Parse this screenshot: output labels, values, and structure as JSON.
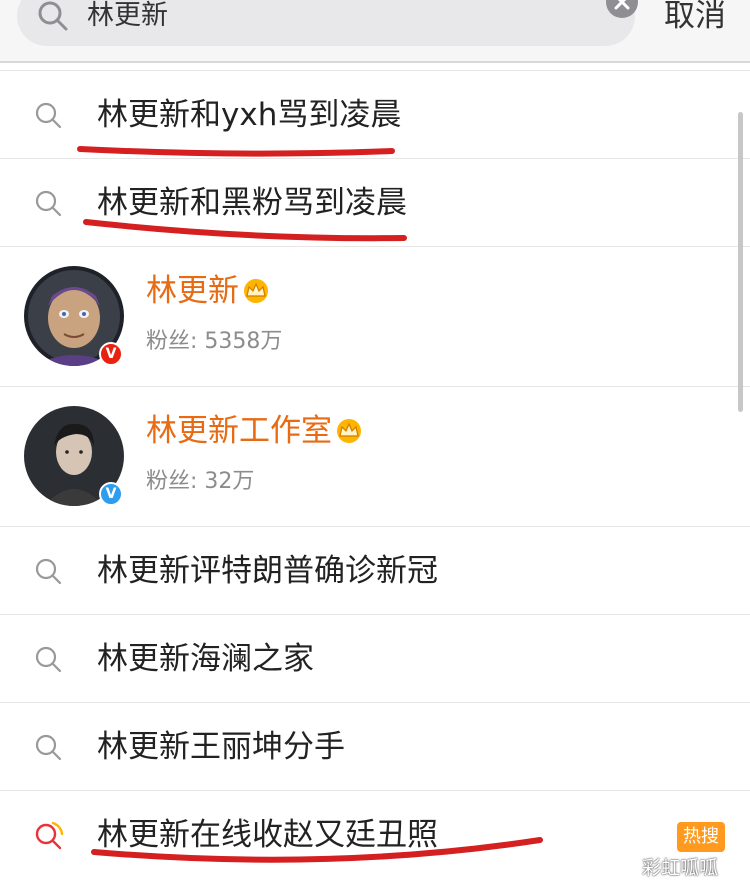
{
  "search": {
    "query": "林更新",
    "cancel_label": "取消"
  },
  "suggestions_top": [
    {
      "text": "林更新和yxh骂到凌晨"
    },
    {
      "text": "林更新和黑粉骂到凌晨"
    }
  ],
  "users": [
    {
      "name": "林更新",
      "fans_label": "粉丝: 5358万",
      "verified": "gold-v"
    },
    {
      "name": "林更新工作室",
      "fans_label": "粉丝: 32万",
      "verified": "blue-v"
    }
  ],
  "suggestions_bottom": [
    {
      "text": "林更新评特朗普确诊新冠"
    },
    {
      "text": "林更新海澜之家"
    },
    {
      "text": "林更新王丽坤分手"
    },
    {
      "text": "林更新在线收赵又廷丑照",
      "tag": "热搜"
    }
  ],
  "watermark": "彩虹呱呱",
  "colors": {
    "username": "#e86a13",
    "hot_tag": "#ff9a1f",
    "annotation_line": "#d42020"
  }
}
